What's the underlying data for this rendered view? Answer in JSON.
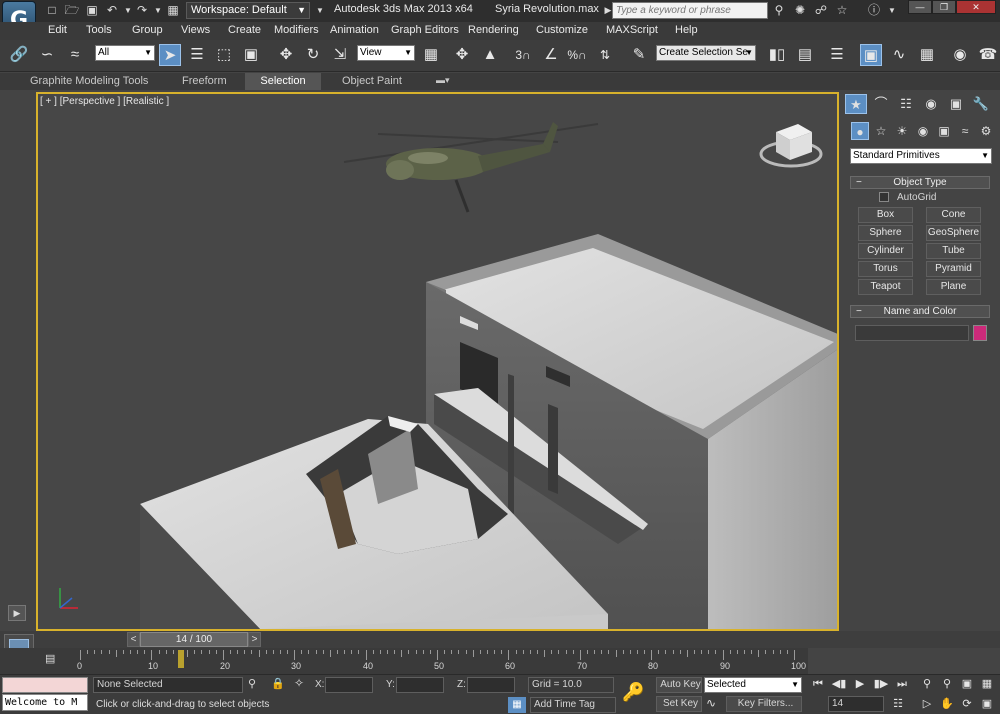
{
  "titlebar": {
    "workspace": "Workspace: Default",
    "app_title": "Autodesk 3ds Max  2013 x64",
    "file_title": "Syria Revolution.max",
    "search_placeholder": "Type a keyword or phrase"
  },
  "menu": [
    "Edit",
    "Tools",
    "Group",
    "Views",
    "Create",
    "Modifiers",
    "Animation",
    "Graph Editors",
    "Rendering",
    "Customize",
    "MAXScript",
    "Help"
  ],
  "toolbar": {
    "filter_value": "All",
    "ref_coord_value": "View",
    "named_selection": "Create Selection Se"
  },
  "ribbon": {
    "tabs": [
      "Graphite Modeling Tools",
      "Freeform",
      "Selection",
      "Object Paint"
    ]
  },
  "viewport": {
    "label": "[ + ] [Perspective ] [Realistic ]"
  },
  "command_panel": {
    "category": "Standard Primitives",
    "object_type_title": "Object Type",
    "autogrid": "AutoGrid",
    "buttons": [
      "Box",
      "Cone",
      "Sphere",
      "GeoSphere",
      "Cylinder",
      "Tube",
      "Torus",
      "Pyramid",
      "Teapot",
      "Plane"
    ],
    "name_color_title": "Name and Color",
    "object_color": "#cc2a7a"
  },
  "timeline": {
    "frame": "14 / 100",
    "ticks": [
      "0",
      "10",
      "20",
      "30",
      "40",
      "50",
      "60",
      "70",
      "80",
      "90",
      "100"
    ]
  },
  "status": {
    "listener": "Welcome to M",
    "selection": "None Selected",
    "prompt": "Click or click-and-drag to select objects",
    "x_label": "X:",
    "y_label": "Y:",
    "z_label": "Z:",
    "grid": "Grid = 10.0",
    "add_time_tag": "Add Time Tag",
    "auto_key": "Auto Key",
    "set_key": "Set Key",
    "key_mode": "Selected",
    "key_filters": "Key Filters...",
    "current_frame": "14"
  }
}
